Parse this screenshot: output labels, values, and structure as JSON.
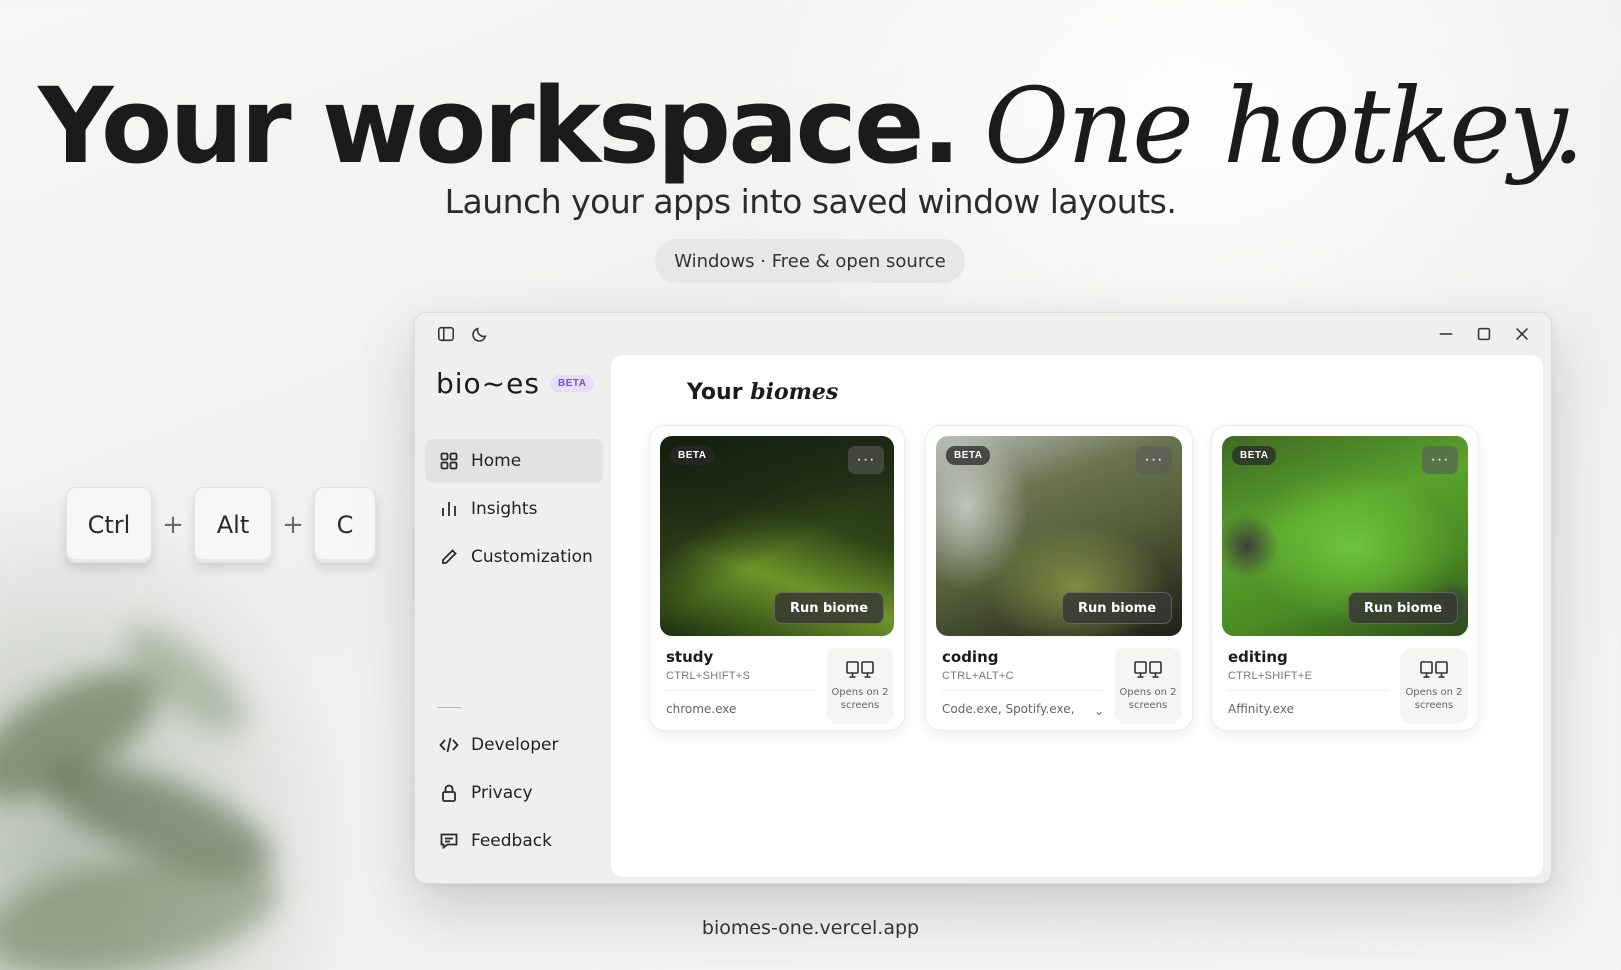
{
  "hero": {
    "title_bold": "Your workspace.",
    "title_italic": "One hotkey.",
    "subtitle": "Launch your apps into saved window layouts.",
    "pill": "Windows · Free & open source"
  },
  "hotkey": {
    "keys": [
      "Ctrl",
      "Alt",
      "C"
    ],
    "separator": "+"
  },
  "app": {
    "logo": "bio~es",
    "logo_badge": "BETA",
    "titlebar_icons": [
      "sidebar-toggle-icon",
      "moon-icon"
    ],
    "window_controls": [
      "minimize-icon",
      "maximize-icon",
      "close-icon"
    ],
    "nav_top": [
      {
        "label": "Home",
        "icon": "grid-icon",
        "active": true
      },
      {
        "label": "Insights",
        "icon": "bar-chart-icon",
        "active": false
      },
      {
        "label": "Customization",
        "icon": "pencil-icon",
        "active": false
      }
    ],
    "nav_bottom": [
      {
        "label": "Developer",
        "icon": "code-icon"
      },
      {
        "label": "Privacy",
        "icon": "lock-icon"
      },
      {
        "label": "Feedback",
        "icon": "message-icon"
      }
    ],
    "panel_title": {
      "plain": "Your",
      "italic": "biomes"
    },
    "cards": [
      {
        "badge": "BETA",
        "more": "···",
        "run_label": "Run biome",
        "name": "study",
        "hotkey": "CTRL+SHIFT+S",
        "apps": "chrome.exe",
        "has_chevron": false,
        "screens": "Opens on 2 screens",
        "image": "mossy-hillside"
      },
      {
        "badge": "BETA",
        "more": "···",
        "run_label": "Run biome",
        "name": "coding",
        "hotkey": "CTRL+ALT+C",
        "apps": "Code.exe, Spotify.exe,",
        "has_chevron": true,
        "chevron": "⌄",
        "screens": "Opens on 2 screens",
        "image": "mossy-tree-fog"
      },
      {
        "badge": "BETA",
        "more": "···",
        "run_label": "Run biome",
        "name": "editing",
        "hotkey": "CTRL+SHIFT+E",
        "apps": "Affinity.exe",
        "has_chevron": false,
        "screens": "Opens on 2 screens",
        "image": "moss-rocks-dew"
      }
    ]
  },
  "footer": {
    "url": "biomes-one.vercel.app"
  },
  "colors": {
    "accent_badge_bg": "#e4dff7",
    "accent_badge_text": "#6a55c2",
    "active_nav_bg": "#e2e2e1"
  }
}
